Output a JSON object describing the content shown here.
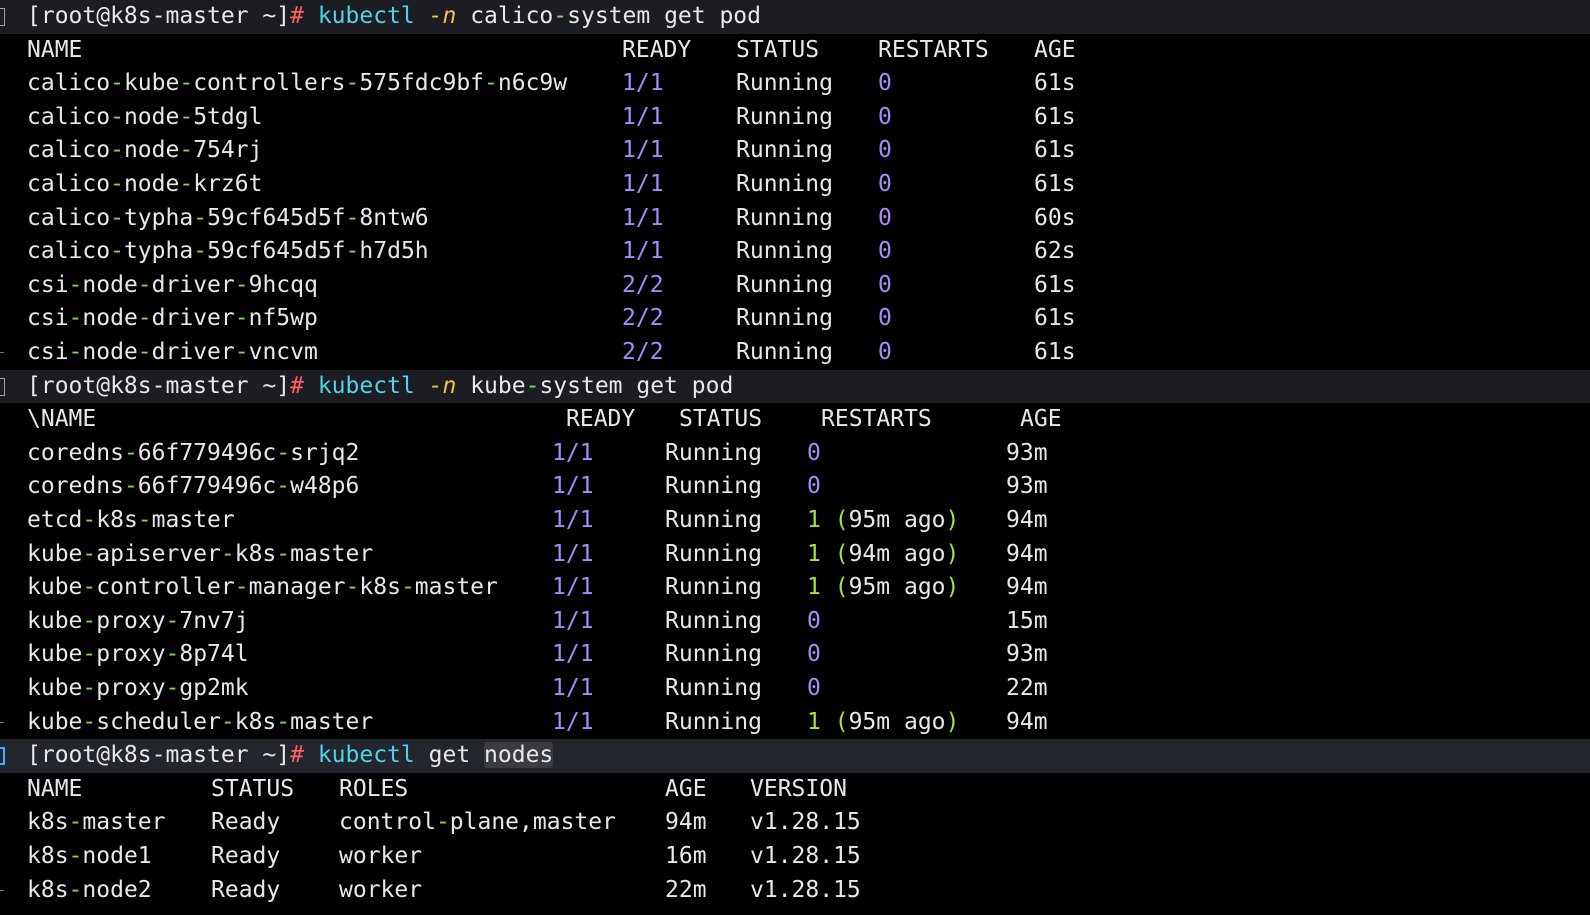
{
  "prompt": {
    "user_host": "[root@k8s-master ~]",
    "symbol": "#"
  },
  "commands": [
    {
      "bin": "kubectl",
      "flag": "-n",
      "args": "calico-system get pod"
    },
    {
      "bin": "kubectl",
      "flag": "-n",
      "args": "kube-system get pod"
    },
    {
      "bin": "kubectl",
      "args_plain": "get",
      "args_highlight": "nodes"
    }
  ],
  "calico": {
    "headers": [
      "NAME",
      "READY",
      "STATUS",
      "RESTARTS",
      "AGE"
    ],
    "rows": [
      {
        "name": "calico-kube-controllers-575fdc9bf-n6c9w",
        "ready": "1/1",
        "status": "Running",
        "restarts": "0",
        "age": "61s"
      },
      {
        "name": "calico-node-5tdgl",
        "ready": "1/1",
        "status": "Running",
        "restarts": "0",
        "age": "61s"
      },
      {
        "name": "calico-node-754rj",
        "ready": "1/1",
        "status": "Running",
        "restarts": "0",
        "age": "61s"
      },
      {
        "name": "calico-node-krz6t",
        "ready": "1/1",
        "status": "Running",
        "restarts": "0",
        "age": "61s"
      },
      {
        "name": "calico-typha-59cf645d5f-8ntw6",
        "ready": "1/1",
        "status": "Running",
        "restarts": "0",
        "age": "60s"
      },
      {
        "name": "calico-typha-59cf645d5f-h7d5h",
        "ready": "1/1",
        "status": "Running",
        "restarts": "0",
        "age": "62s"
      },
      {
        "name": "csi-node-driver-9hcqq",
        "ready": "2/2",
        "status": "Running",
        "restarts": "0",
        "age": "61s"
      },
      {
        "name": "csi-node-driver-nf5wp",
        "ready": "2/2",
        "status": "Running",
        "restarts": "0",
        "age": "61s"
      },
      {
        "name": "csi-node-driver-vncvm",
        "ready": "2/2",
        "status": "Running",
        "restarts": "0",
        "age": "61s"
      }
    ]
  },
  "kube_system": {
    "headers": [
      "\\NAME",
      "READY",
      "STATUS",
      "RESTARTS",
      "AGE"
    ],
    "rows": [
      {
        "name": "coredns-66f779496c-srjq2",
        "ready": "1/1",
        "status": "Running",
        "restarts": "0",
        "restarts_ago": "",
        "age": "93m"
      },
      {
        "name": "coredns-66f779496c-w48p6",
        "ready": "1/1",
        "status": "Running",
        "restarts": "0",
        "restarts_ago": "",
        "age": "93m"
      },
      {
        "name": "etcd-k8s-master",
        "ready": "1/1",
        "status": "Running",
        "restarts": "1",
        "restarts_ago": "95m ago",
        "age": "94m"
      },
      {
        "name": "kube-apiserver-k8s-master",
        "ready": "1/1",
        "status": "Running",
        "restarts": "1",
        "restarts_ago": "94m ago",
        "age": "94m"
      },
      {
        "name": "kube-controller-manager-k8s-master",
        "ready": "1/1",
        "status": "Running",
        "restarts": "1",
        "restarts_ago": "95m ago",
        "age": "94m"
      },
      {
        "name": "kube-proxy-7nv7j",
        "ready": "1/1",
        "status": "Running",
        "restarts": "0",
        "restarts_ago": "",
        "age": "15m"
      },
      {
        "name": "kube-proxy-8p74l",
        "ready": "1/1",
        "status": "Running",
        "restarts": "0",
        "restarts_ago": "",
        "age": "93m"
      },
      {
        "name": "kube-proxy-gp2mk",
        "ready": "1/1",
        "status": "Running",
        "restarts": "0",
        "restarts_ago": "",
        "age": "22m"
      },
      {
        "name": "kube-scheduler-k8s-master",
        "ready": "1/1",
        "status": "Running",
        "restarts": "1",
        "restarts_ago": "95m ago",
        "age": "94m"
      }
    ]
  },
  "nodes": {
    "headers": [
      "NAME",
      "STATUS",
      "ROLES",
      "AGE",
      "VERSION"
    ],
    "rows": [
      {
        "name": "k8s-master",
        "status": "Ready",
        "roles": "control-plane,master",
        "age": "94m",
        "version": "v1.28.15"
      },
      {
        "name": "k8s-node1",
        "status": "Ready",
        "roles": "worker",
        "age": "16m",
        "version": "v1.28.15"
      },
      {
        "name": "k8s-node2",
        "status": "Ready",
        "roles": "worker",
        "age": "22m",
        "version": "v1.28.15"
      }
    ]
  },
  "colors": {
    "background": "#000000",
    "prompt_hash": "#ff5f6b",
    "command": "#4fd1e8",
    "flag": "#f2c14e",
    "number": "#a78bfa",
    "dash": "#7ed957"
  }
}
